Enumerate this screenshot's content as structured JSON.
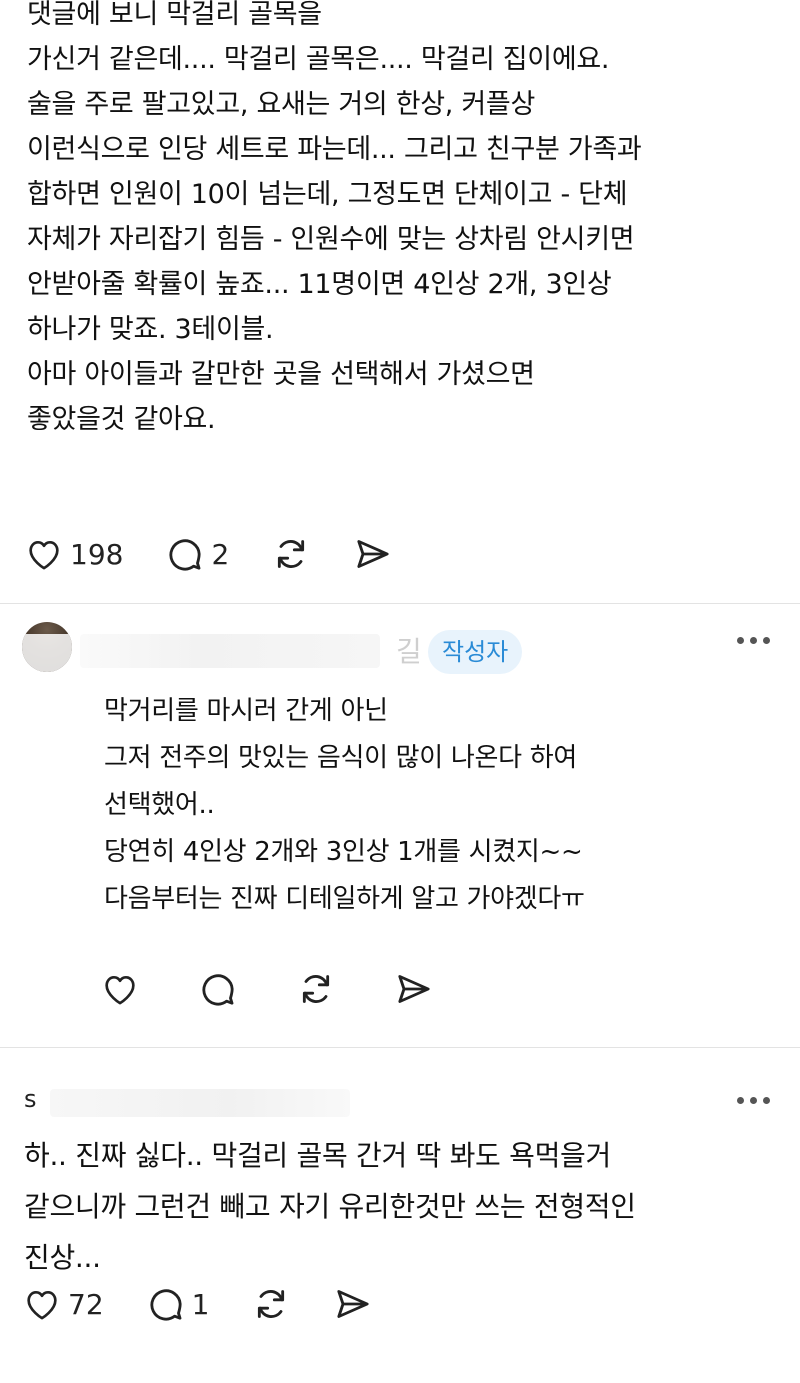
{
  "post": {
    "lines": [
      "댓글에 보니 막걸리 골목을",
      "가신거 같은데.... 막걸리 골목은.... 막걸리 집이에요.",
      "술을 주로 팔고있고, 요새는 거의 한상, 커플상",
      "이런식으로 인당 세트로 파는데... 그리고 친구분 가족과",
      "합하면 인원이 10이 넘는데, 그정도면 단체이고 - 단체",
      "자체가 자리잡기 힘듬 - 인원수에 맞는 상차림 안시키면",
      "안받아줄 확률이 높죠... 11명이면 4인상 2개, 3인상",
      "하나가 맞죠. 3테이블.",
      "아마 아이들과 갈만한 곳을 선택해서 가셨으면",
      "좋았을것 같아요."
    ],
    "likes": "198",
    "comments": "2"
  },
  "reply": {
    "name_fragment": "길",
    "badge": "작성자",
    "lines": [
      "막거리를 마시러 간게 아닌",
      "그저 전주의 맛있는 음식이 많이 나온다 하여",
      "선택했어..",
      "당연히 4인상 2개와 3인상 1개를 시켰지~~",
      "다음부터는 진짜 디테일하게 알고 가야겠다ㅠ"
    ]
  },
  "comment2": {
    "user_initial": "s",
    "lines": [
      "하.. 진짜 싫다.. 막걸리 골목 간거 딱 봐도 욕먹을거",
      "같으니까 그런건 빼고 자기 유리한것만 쓰는 전형적인",
      "진상..."
    ],
    "likes": "72",
    "comments": "1"
  },
  "icons": [
    "heart-icon",
    "comment-icon",
    "repost-icon",
    "share-icon",
    "more-icon"
  ]
}
